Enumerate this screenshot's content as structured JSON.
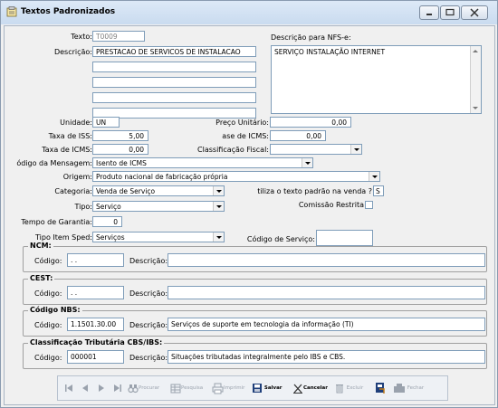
{
  "window": {
    "title": "Textos Padronizados"
  },
  "form": {
    "texto_label": "Texto:",
    "texto_value": "T0009",
    "descricao_label": "Descrição:",
    "descricao_value": "PRESTACAO DE SERVICOS DE INSTALACAO",
    "desc_nfse_label": "Descrição para NFS-e:",
    "desc_nfse_value": "SERVIÇO INSTALAÇÃO INTERNET",
    "unidade_label": "Unidade:",
    "unidade_value": "UN",
    "preco_label": "Preço Unitário:",
    "preco_value": "0,00",
    "taxa_iss_label": "Taxa de ISS:",
    "taxa_iss_value": "5,00",
    "base_icms_label": "ase de ICMS:",
    "base_icms_value": "0,00",
    "taxa_icms_label": "Taxa de ICMS:",
    "taxa_icms_value": "0,00",
    "class_fiscal_label": "Classificação Fiscal:",
    "class_fiscal_value": "",
    "cod_msg_label": "ódigo da Mensagem:",
    "cod_msg_value": "Isento de ICMS",
    "origem_label": "Origem:",
    "origem_value": "Produto nacional de fabricação própria",
    "categoria_label": "Categoria:",
    "categoria_value": "Venda de Serviço",
    "utiliza_label": "tiliza o texto padrão na venda ?",
    "utiliza_value": "S",
    "tipo_label": "Tipo:",
    "tipo_value": "Serviço",
    "comissao_label": "Comissão Restrita",
    "garantia_label": "Tempo de Garantia:",
    "garantia_value": "0",
    "tipo_sped_label": "Tipo Item Sped:",
    "tipo_sped_value": "Serviços",
    "cod_servico_label": "Código de Serviço:",
    "cod_servico_value": ""
  },
  "groups": [
    {
      "title": "NCM:",
      "codigo_label": "Código:",
      "codigo_value": " .  .",
      "descricao_label": "Descrição:",
      "descricao_value": ""
    },
    {
      "title": "CEST:",
      "codigo_label": "Código:",
      "codigo_value": " .  .",
      "descricao_label": "Descrição:",
      "descricao_value": ""
    },
    {
      "title": "Código NBS:",
      "codigo_label": "Código:",
      "codigo_value": "1.1501.30.00",
      "descricao_label": "Descrição:",
      "descricao_value": "Serviços de suporte em tecnologia da informação (TI)"
    },
    {
      "title": "Classificação Tributária CBS/IBS:",
      "codigo_label": "Código:",
      "codigo_value": "000001",
      "descricao_label": "Descrição:",
      "descricao_value": "Situações tributadas integralmente pelo IBS e CBS."
    }
  ],
  "toolbar": {
    "procurar": "Procurar",
    "pesquisa": "Pesquisa",
    "imprimir": "Imprimir",
    "salvar": "Salvar",
    "cancelar": "Cancelar",
    "excluir": "Excluir",
    "fechar": "Fechar"
  },
  "colors": {
    "title_gradient_top": "#dde9f7",
    "title_gradient_bottom": "#c9dbef",
    "field_border": "#7f9db9"
  },
  "icons": [
    "window-icon",
    "minimize-icon",
    "maximize-icon",
    "close-icon",
    "first-icon",
    "prev-icon",
    "next-icon",
    "last-icon",
    "binoculars-icon",
    "grid-icon",
    "printer-icon",
    "save-icon",
    "cancel-icon",
    "trash-icon",
    "undo-icon",
    "door-icon"
  ]
}
